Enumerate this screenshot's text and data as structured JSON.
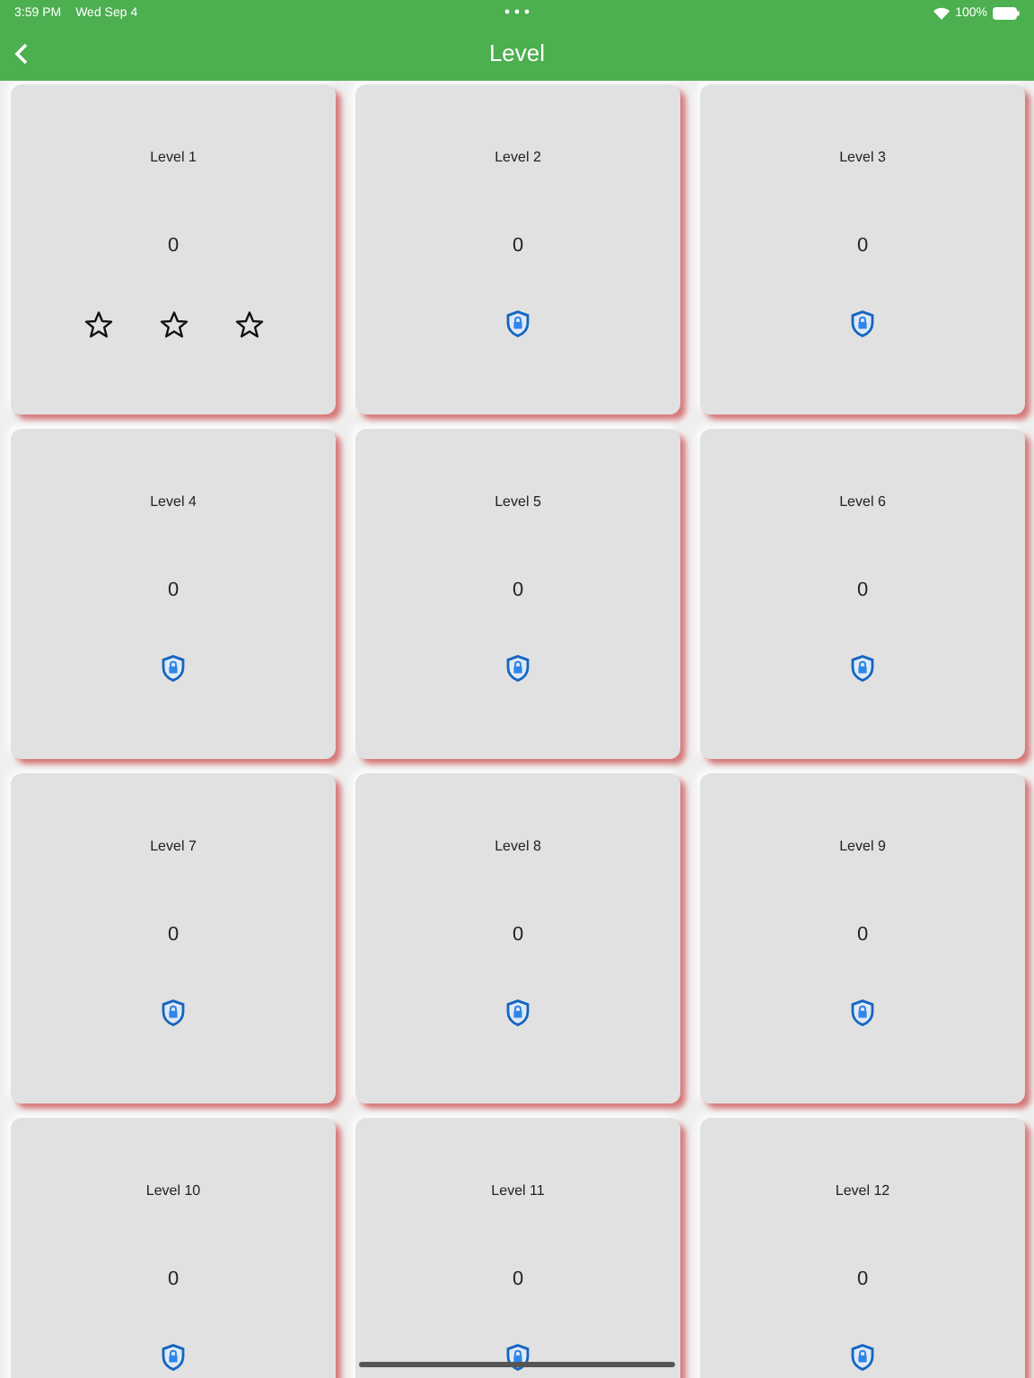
{
  "status_bar": {
    "time": "3:59 PM",
    "date": "Wed Sep 4",
    "battery": "100%"
  },
  "nav": {
    "title": "Level"
  },
  "levels": [
    {
      "title": "Level 1",
      "score": "0",
      "locked": false,
      "stars": 0
    },
    {
      "title": "Level 2",
      "score": "0",
      "locked": true
    },
    {
      "title": "Level 3",
      "score": "0",
      "locked": true
    },
    {
      "title": "Level 4",
      "score": "0",
      "locked": true
    },
    {
      "title": "Level 5",
      "score": "0",
      "locked": true
    },
    {
      "title": "Level 6",
      "score": "0",
      "locked": true
    },
    {
      "title": "Level 7",
      "score": "0",
      "locked": true
    },
    {
      "title": "Level 8",
      "score": "0",
      "locked": true
    },
    {
      "title": "Level 9",
      "score": "0",
      "locked": true
    },
    {
      "title": "Level 10",
      "score": "0",
      "locked": true
    },
    {
      "title": "Level 11",
      "score": "0",
      "locked": true
    },
    {
      "title": "Level 12",
      "score": "0",
      "locked": true
    }
  ]
}
